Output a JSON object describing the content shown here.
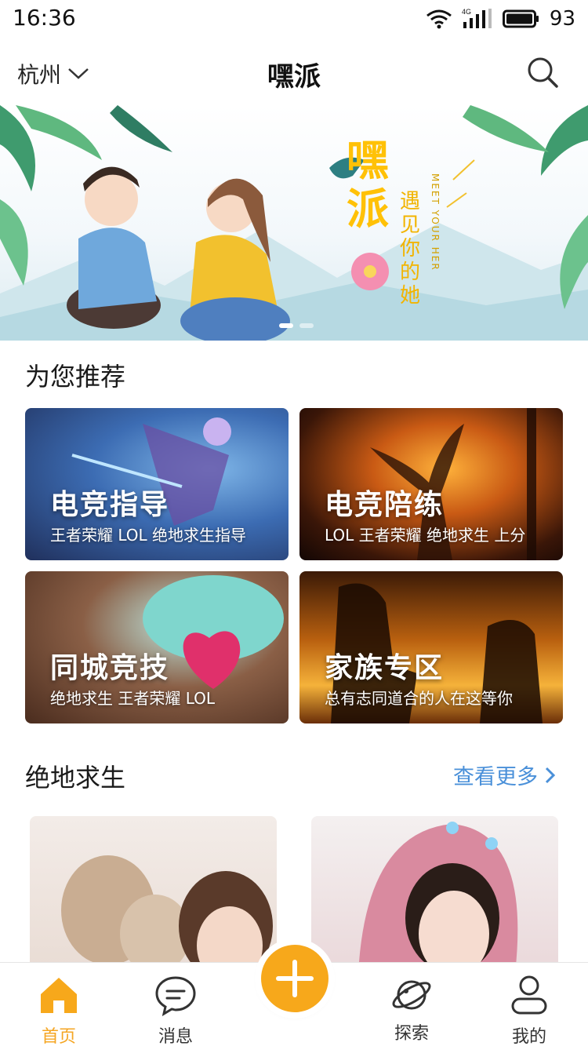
{
  "status_bar": {
    "time": "16:36",
    "battery": "93",
    "network": "4G"
  },
  "header": {
    "city": "杭州",
    "title": "嘿派"
  },
  "banner": {
    "brand": "嘿派",
    "slogan": "遇见你的她",
    "slogan_en": "MEET YOUR HER",
    "active_slide": 1,
    "slide_count": 2
  },
  "recommend": {
    "title": "为您推荐",
    "cards": [
      {
        "title": "电竞指导",
        "subtitle": "王者荣耀 LOL 绝地求生指导"
      },
      {
        "title": "电竞陪练",
        "subtitle": "LOL 王者荣耀 绝地求生 上分"
      },
      {
        "title": "同城竞技",
        "subtitle": "绝地求生 王者荣耀 LOL"
      },
      {
        "title": "家族专区",
        "subtitle": "总有志同道合的人在这等你"
      }
    ]
  },
  "pubg": {
    "title": "绝地求生",
    "more": "查看更多"
  },
  "tabs": [
    {
      "label": "首页",
      "icon": "home-icon",
      "active": true
    },
    {
      "label": "消息",
      "icon": "message-icon",
      "active": false
    },
    {
      "label": "探索",
      "icon": "planet-icon",
      "active": false
    },
    {
      "label": "我的",
      "icon": "profile-icon",
      "active": false
    }
  ],
  "colors": {
    "accent": "#f7a81b",
    "link": "#4a90d9",
    "brand_yellow": "#ffc107"
  }
}
